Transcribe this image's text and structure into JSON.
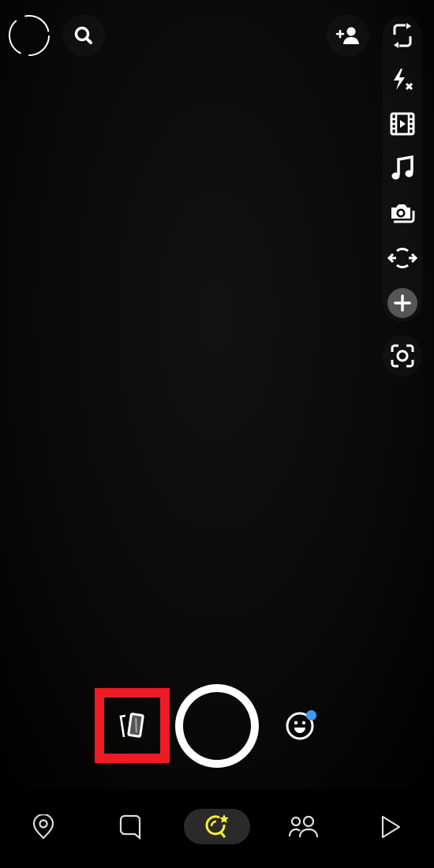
{
  "colors": {
    "accent_yellow": "#f5f03a",
    "highlight_red": "#ed1c24",
    "notification_blue": "#3d9bf0",
    "nav_pill": "#2b2a28",
    "plus_bg": "#555555"
  },
  "top_bar": {
    "left": [
      "avatar",
      "search-icon"
    ],
    "right": [
      "add-friend-icon"
    ]
  },
  "camera_tools": [
    "flip-camera-icon",
    "flash-off-icon",
    "video-icon",
    "music-icon",
    "multi-snap-icon",
    "dual-camera-icon",
    "plus-icon",
    "scan-icon"
  ],
  "capture_bar": {
    "memories": "memories-icon",
    "shutter": "shutter-button",
    "lenses": "lens-smiley-icon",
    "lenses_has_notification": true
  },
  "bottom_nav": {
    "items": [
      "map-icon",
      "chat-icon",
      "camera-lens-icon",
      "friends-icon",
      "spotlight-icon"
    ],
    "active": "camera-lens-icon"
  }
}
